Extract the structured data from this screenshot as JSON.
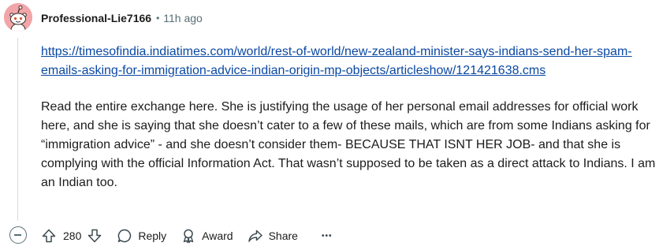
{
  "comment": {
    "username": "Professional-Lie7166",
    "separator": "•",
    "timestamp": "11h ago",
    "link": "https://timesofindia.indiatimes.com/world/rest-of-world/new-zealand-minister-says-indians-send-her-spam-emails-asking-for-immigration-advice-indian-origin-mp-objects/articleshow/121421638.cms",
    "body": "Read the entire exchange here. She is justifying the usage of her personal email addresses for official work here, and she is saying that she doesn’t cater to a few of these mails, which are from some Indians asking for “immigration advice” - and she doesn’t consider them- BECAUSE THAT ISNT HER JOB- and that she is complying with the official Information Act. That wasn’t supposed to be taken as a direct attack to Indians. I am an Indian too."
  },
  "actions": {
    "score": "280",
    "reply_label": "Reply",
    "award_label": "Award",
    "share_label": "Share",
    "more_label": "•••"
  },
  "icons": {
    "avatar": "reddit-snoo-avatar-icon",
    "upvote": "arrow-up-icon",
    "downvote": "arrow-down-icon",
    "reply": "speech-bubble-icon",
    "award": "award-ribbon-icon",
    "share": "share-arrow-icon",
    "collapse": "minus-circle-icon"
  },
  "colors": {
    "avatar_bg": "#f2a5a8",
    "link": "#0a48a3",
    "meta_text": "#576f76",
    "text": "#1c1c1c"
  }
}
